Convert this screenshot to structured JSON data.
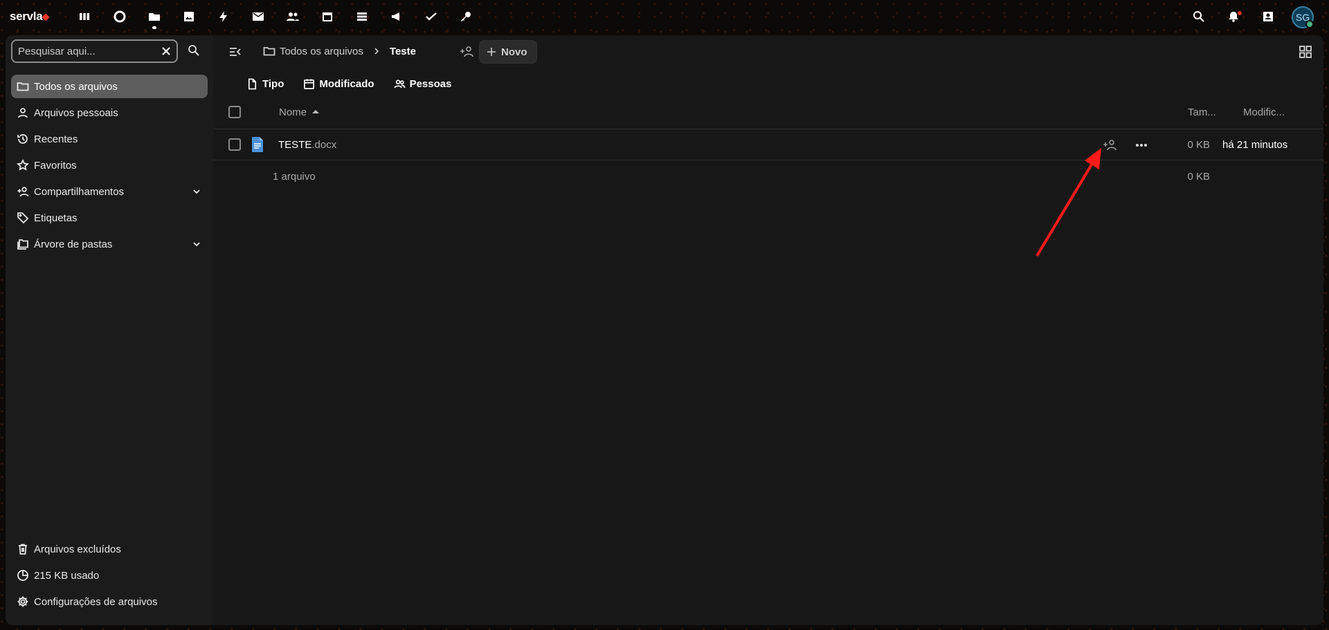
{
  "brand": {
    "logo_text": "servla"
  },
  "topbar": {
    "apps": [
      {
        "name": "dashboard-icon"
      },
      {
        "name": "circle-app-icon"
      },
      {
        "name": "files-icon"
      },
      {
        "name": "photos-icon"
      },
      {
        "name": "activity-icon"
      },
      {
        "name": "mail-icon"
      },
      {
        "name": "contacts-icon"
      },
      {
        "name": "calendar-icon"
      },
      {
        "name": "deck-icon"
      },
      {
        "name": "announcements-icon"
      },
      {
        "name": "tasks-icon"
      },
      {
        "name": "passwords-icon"
      }
    ],
    "avatar_initials": "SG"
  },
  "sidebar": {
    "search_placeholder": "Pesquisar aqui...",
    "items": [
      {
        "label": "Todos os arquivos",
        "icon": "folder-icon",
        "active": true
      },
      {
        "label": "Arquivos pessoais",
        "icon": "user-icon"
      },
      {
        "label": "Recentes",
        "icon": "history-icon"
      },
      {
        "label": "Favoritos",
        "icon": "star-icon"
      },
      {
        "label": "Compartilhamentos",
        "icon": "share-icon",
        "expandable": true
      },
      {
        "label": "Etiquetas",
        "icon": "tag-icon"
      },
      {
        "label": "Árvore de pastas",
        "icon": "folder-tree-icon",
        "expandable": true
      }
    ],
    "bottom": {
      "trash": "Arquivos excluídos",
      "quota": "215 KB usado",
      "settings": "Configurações de arquivos"
    }
  },
  "header": {
    "breadcrumb_root": "Todos os arquivos",
    "breadcrumb_current": "Teste",
    "new_label": "Novo"
  },
  "filters": {
    "type": "Tipo",
    "modified": "Modificado",
    "people": "Pessoas"
  },
  "table": {
    "columns": {
      "name": "Nome",
      "size": "Tam...",
      "modified": "Modific..."
    },
    "rows": [
      {
        "name": "TESTE",
        "ext": ".docx",
        "size": "0 KB",
        "modified": "há 21 minutos"
      }
    ],
    "summary": {
      "count": "1 arquivo",
      "size": "0 KB"
    }
  },
  "colors": {
    "accent": "#e8352b",
    "file_icon": "#4a90d9",
    "active_nav": "#5d5d5d",
    "annotation_arrow": "#ff1a1a"
  }
}
